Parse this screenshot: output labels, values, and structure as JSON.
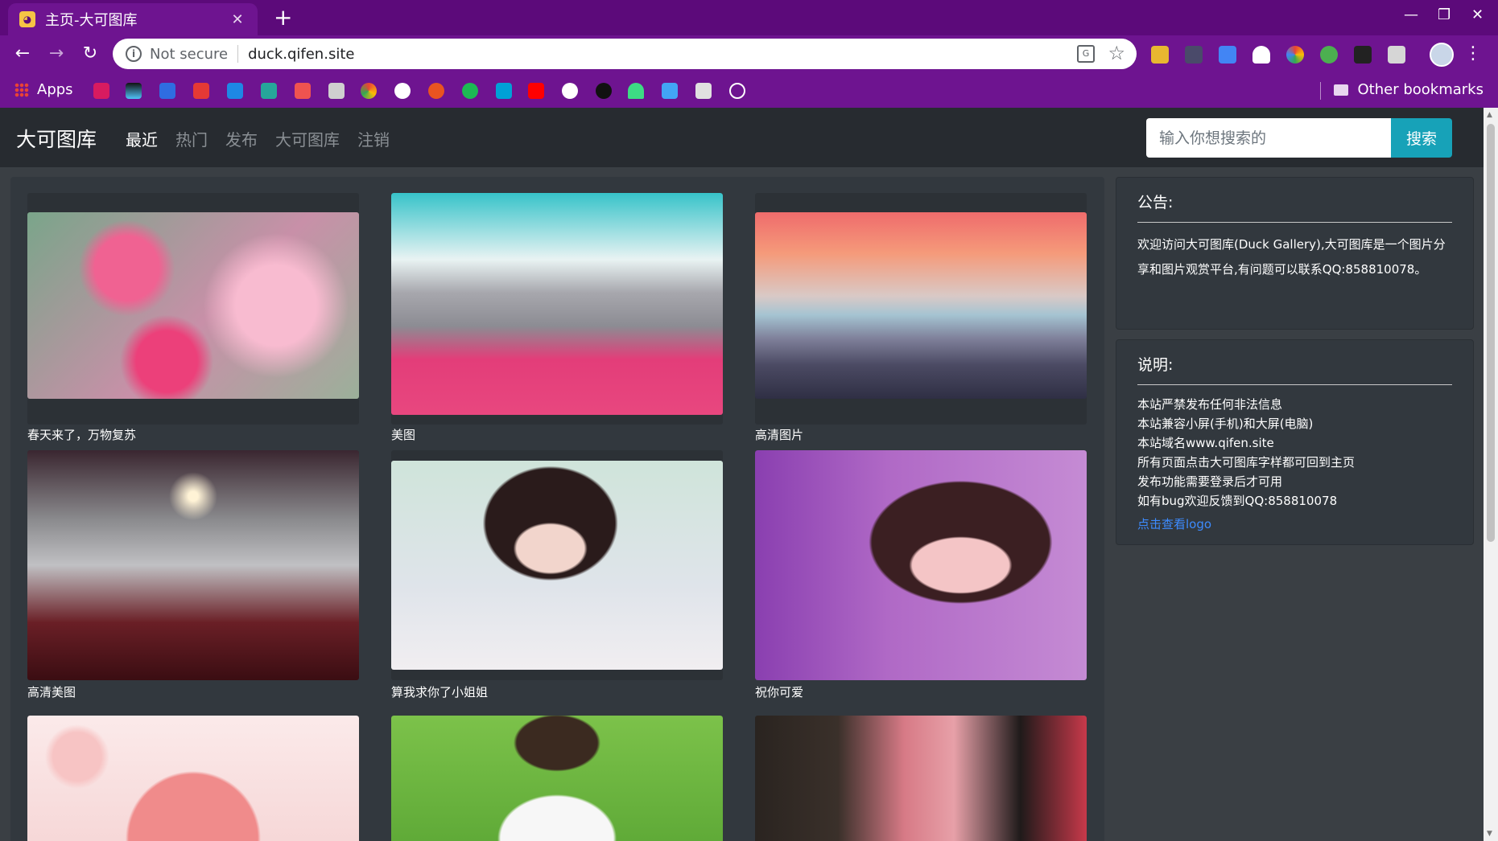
{
  "browser": {
    "tab_title": "主页-大可图库",
    "tab_close": "✕",
    "new_tab": "+",
    "security_label": "Not secure",
    "url": "duck.qifen.site",
    "bookmarks_apps": "Apps",
    "other_bookmarks": "Other bookmarks"
  },
  "nav": {
    "brand": "大可图库",
    "links": [
      "最近",
      "热门",
      "发布",
      "大可图库",
      "注销"
    ],
    "active_link": "最近",
    "search_placeholder": "输入你想搜索的",
    "search_button": "搜索"
  },
  "gallery": {
    "items": [
      {
        "caption": "春天来了，万物复苏",
        "image": "pink-carnation-flowers"
      },
      {
        "caption": "美图",
        "image": "pink-city-skyline"
      },
      {
        "caption": "高清图片",
        "image": "sunset-mountains"
      },
      {
        "caption": "高清美图",
        "image": "kimono-figure"
      },
      {
        "caption": "算我求你了小姐姐",
        "image": "girl-braids-portrait"
      },
      {
        "caption": "祝你可爱",
        "image": "girl-purple-portrait"
      },
      {
        "caption": "",
        "image": "anime-girl-pink-hair"
      },
      {
        "caption": "",
        "image": "girl-on-grass"
      },
      {
        "caption": "",
        "image": "girl-pink-blouse"
      }
    ]
  },
  "notice": {
    "title": "公告:",
    "text": "欢迎访问大可图库(Duck Gallery),大可图库是一个图片分享和图片观赏平台,有问题可以联系QQ:858810078。"
  },
  "info": {
    "title": "说明:",
    "lines": [
      "本站严禁发布任何非法信息",
      "本站兼容小屏(手机)和大屏(电脑)",
      "本站域名www.qifen.site",
      "所有页面点击大可图库字样都可回到主页",
      "发布功能需要登录后才可用",
      "如有bug欢迎反馈到QQ:858810078"
    ],
    "link": "点击查看logo"
  },
  "colors": {
    "browser_frame": "#6e1490",
    "navbar": "#272b30",
    "page_bg": "#3a3f44",
    "search_button": "#17a2b8",
    "link": "#3d8bfd"
  }
}
